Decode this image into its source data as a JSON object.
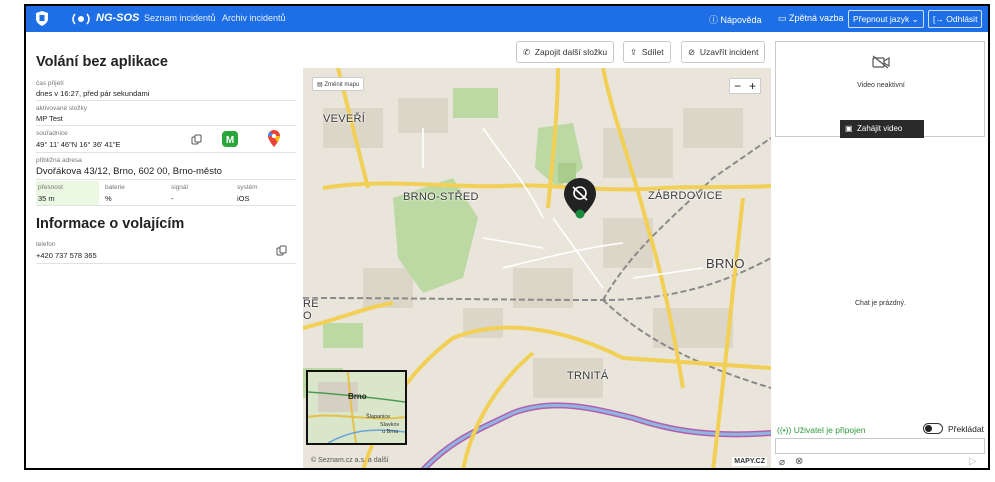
{
  "header": {
    "brand": "NG-SOS",
    "nav": [
      "Seznam incidentů",
      "Archiv incidentů"
    ],
    "help": "Nápověda",
    "feedback": "Zpětná vazba",
    "language": "Přepnout jazyk",
    "logout": "Odhlásit",
    "color": "#1e6fe6"
  },
  "actions": {
    "connect": "Zapojit další složku",
    "share": "Sdílet",
    "close": "Uzavřít incident"
  },
  "call": {
    "title": "Volání bez aplikace",
    "received_label": "čas přijetí",
    "received_value": "dnes v 16:27, před pár sekundami",
    "units_label": "aktivované složky",
    "units_value": "MP Test",
    "coords_label": "souřadnice",
    "coords_value": "49° 11' 46\"N 16° 36' 41\"E",
    "address_label": "přibližná adresa",
    "address_value": "Dvořákova 43/12, Brno, 602 00, Brno-město",
    "accuracy_label": "přesnost",
    "accuracy_value": "35 m",
    "battery_label": "baterie",
    "battery_value": "%",
    "signal_label": "signál",
    "signal_value": "-",
    "system_label": "systém",
    "system_value": "iOS"
  },
  "caller": {
    "title": "Informace o volajícím",
    "phone_label": "telefon",
    "phone_value": "+420 737 578 365"
  },
  "map": {
    "switch": "Změnit mapu",
    "zoom_out": "−",
    "zoom_in": "+",
    "labels": [
      "VEVEŘÍ",
      "BRNO-STŘED",
      "ZÁBRDOVICE",
      "BRNO",
      "TRNITÁ",
      "RÉ",
      "O"
    ],
    "mini_labels": [
      "Brno",
      "Šlapanice",
      "Slavkov",
      "u Brna"
    ],
    "attribution": "© Seznam.cz a.s. a další",
    "provider": "MAPY.CZ"
  },
  "video": {
    "status": "Video neaktivní",
    "start": "Zahájit video"
  },
  "chat": {
    "empty": "Chat je prázdný.",
    "connected": "Uživatel je připojen",
    "translate": "Překládat",
    "input_placeholder": ""
  }
}
